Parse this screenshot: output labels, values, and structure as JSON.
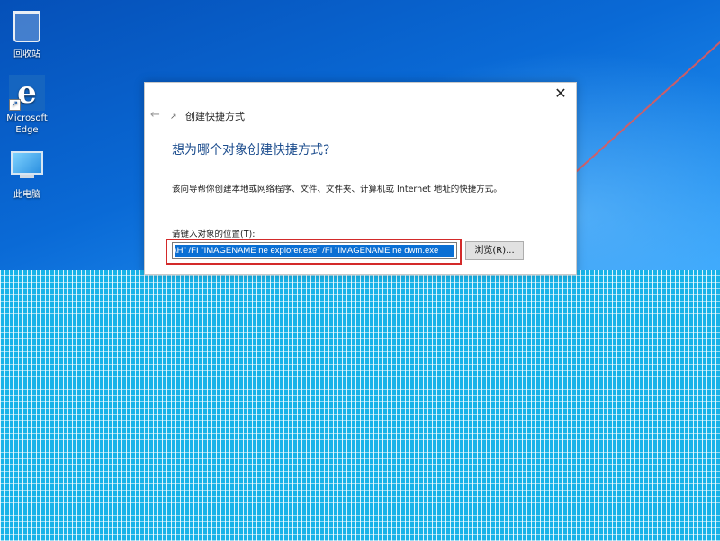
{
  "desktop": {
    "icons": [
      {
        "name": "recycle-bin",
        "label": "回收站"
      },
      {
        "name": "microsoft-edge",
        "label": "Microsoft Edge",
        "label_line1": "Microsoft",
        "label_line2": "Edge"
      },
      {
        "name": "this-pc",
        "label": "此电脑"
      }
    ]
  },
  "dialog": {
    "close_glyph": "✕",
    "back_glyph": "←",
    "window_title": "创建快捷方式",
    "heading": "想为哪个对象创建快捷方式?",
    "description": "该向导帮你创建本地或网络程序、文件、文件夹、计算机或 Internet 地址的快捷方式。",
    "location_label": "请键入对象的位置(T):",
    "location_value": "\\H\" /FI \"IMAGENAME ne explorer.exe\" /FI \"IMAGENAME ne dwm.exe",
    "browse_label": "浏览(R)..."
  },
  "colors": {
    "selection": "#0a6fd4",
    "highlight_border": "#d32a2a",
    "heading": "#1f4f8f"
  }
}
